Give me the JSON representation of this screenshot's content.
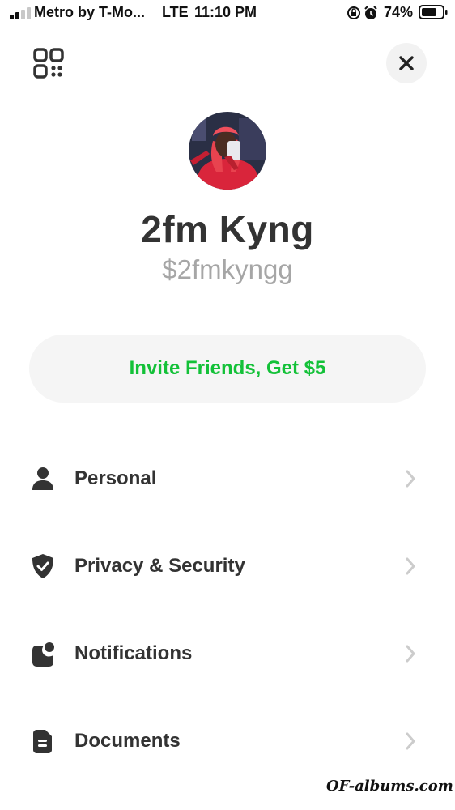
{
  "status_bar": {
    "carrier": "Metro by T-Mo...",
    "network": "LTE",
    "time": "11:10 PM",
    "battery_percent": "74%",
    "icons": [
      "signal-icon",
      "at-lock-icon",
      "alarm-icon",
      "battery-icon"
    ],
    "battery_level": 0.74
  },
  "header": {
    "qr_icon": "qr-code-icon",
    "close_icon": "close-icon"
  },
  "profile": {
    "name": "2fm Kyng",
    "cashtag": "$2fmkyngg"
  },
  "invite": {
    "label": "Invite Friends, Get $5"
  },
  "menu": {
    "items": [
      {
        "label": "Personal",
        "icon": "person-icon"
      },
      {
        "label": "Privacy & Security",
        "icon": "shield-check-icon"
      },
      {
        "label": "Notifications",
        "icon": "notification-badge-icon"
      },
      {
        "label": "Documents",
        "icon": "document-icon"
      }
    ]
  },
  "watermark": {
    "text": "OF-albums.com"
  },
  "colors": {
    "accent_green": "#13c138",
    "text_dark": "#333333",
    "text_muted": "#a6a6a6",
    "chevron": "#cccccc"
  }
}
